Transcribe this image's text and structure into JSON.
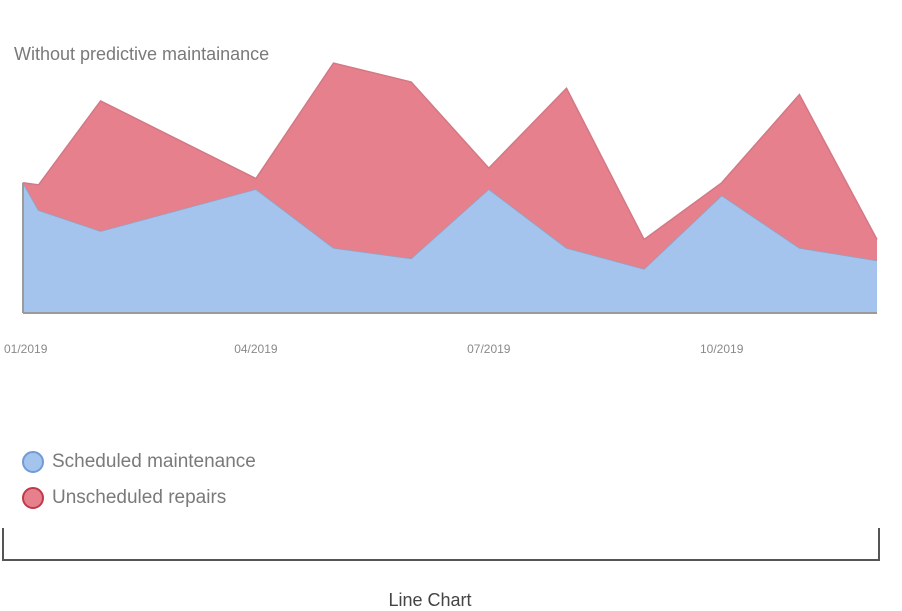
{
  "chart_data": {
    "type": "area",
    "stacked": true,
    "title": "Without predictive maintainance",
    "x_tick_labels": [
      "01/2019",
      "04/2019",
      "07/2019",
      "10/2019"
    ],
    "x": [
      "01/2019",
      "01/2019",
      "02/2019",
      "04/2019",
      "05/2019",
      "06/2019",
      "07/2019",
      "08/2019",
      "09/2019",
      "10/2019",
      "11/2019",
      "12/2019"
    ],
    "series": [
      {
        "name": "Scheduled maintenance",
        "color": "#a4c4ed",
        "stroke": "#6f9bd8",
        "values": [
          62,
          49,
          39,
          59,
          31,
          26,
          59,
          31,
          21,
          56,
          31,
          25
        ]
      },
      {
        "name": "Unscheduled repairs",
        "color": "#e5808c",
        "stroke": "#c0394b",
        "values": [
          0,
          12,
          62,
          5,
          88,
          84,
          10,
          76,
          14,
          6,
          73,
          10
        ]
      }
    ],
    "ylim": [
      0,
      130
    ],
    "grid": false,
    "legend_position": "bottom-left"
  },
  "caption": "Line Chart"
}
